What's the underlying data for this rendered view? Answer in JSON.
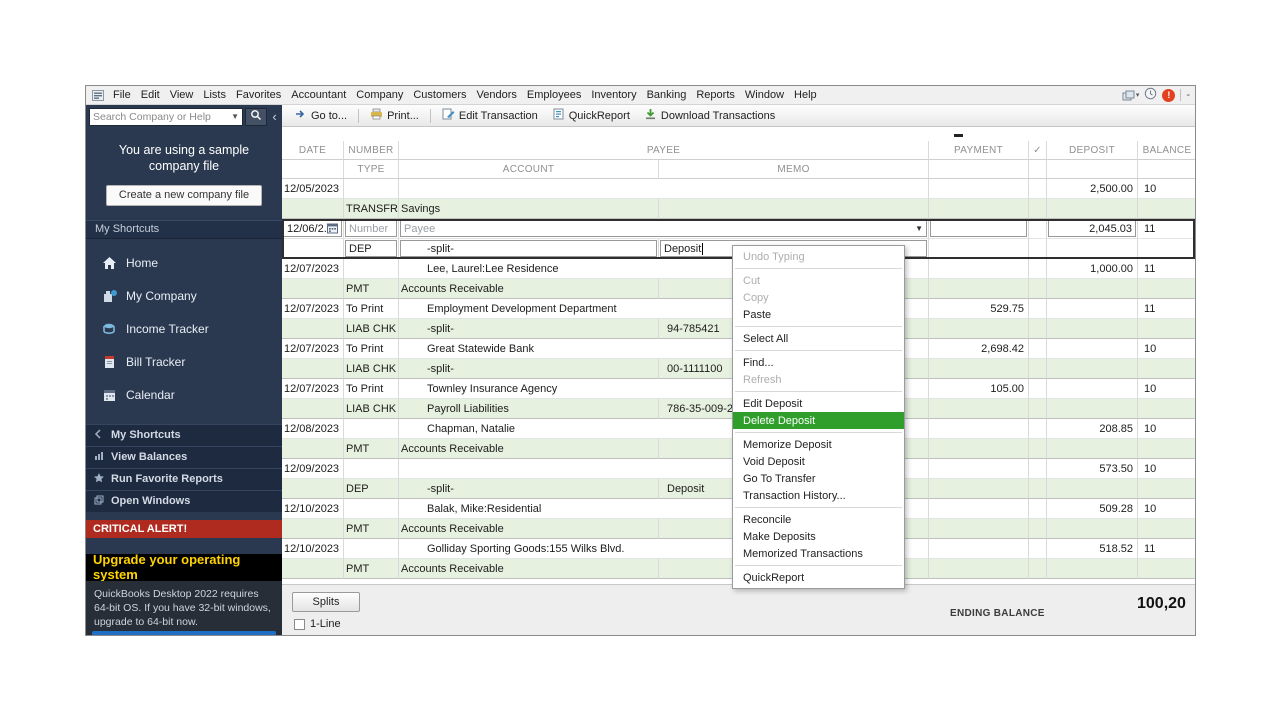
{
  "menubar": {
    "items": [
      "File",
      "Edit",
      "View",
      "Lists",
      "Favorites",
      "Accountant",
      "Company",
      "Customers",
      "Vendors",
      "Employees",
      "Inventory",
      "Banking",
      "Reports",
      "Window",
      "Help"
    ]
  },
  "toolbar": {
    "buttons": [
      {
        "label": "Go to...",
        "icon": "go-to-arrow-icon"
      },
      {
        "label": "Print...",
        "icon": "printer-icon"
      },
      {
        "label": "Edit Transaction",
        "icon": "edit-transaction-icon"
      },
      {
        "label": "QuickReport",
        "icon": "quickreport-icon"
      },
      {
        "label": "Download Transactions",
        "icon": "download-icon"
      }
    ]
  },
  "sidebar": {
    "search_placeholder": "Search Company or Help",
    "sample_banner": "You are using a sample company file",
    "create_company_button": "Create a new company file",
    "shortcuts_header": "My Shortcuts",
    "shortcuts": [
      {
        "label": "Home",
        "icon": "home-icon"
      },
      {
        "label": "My Company",
        "icon": "my-company-icon"
      },
      {
        "label": "Income Tracker",
        "icon": "income-tracker-icon"
      },
      {
        "label": "Bill Tracker",
        "icon": "bill-tracker-icon"
      },
      {
        "label": "Calendar",
        "icon": "calendar-icon"
      }
    ],
    "panels": [
      {
        "label": "My Shortcuts",
        "icon": "my-shortcuts-icon"
      },
      {
        "label": "View Balances",
        "icon": "view-balances-icon"
      },
      {
        "label": "Run Favorite Reports",
        "icon": "favorite-reports-icon"
      },
      {
        "label": "Open Windows",
        "icon": "open-windows-icon"
      }
    ],
    "critical_alert": "CRITICAL ALERT!",
    "upgrade_headline": "Upgrade your operating system",
    "upgrade_body": "QuickBooks Desktop 2022 requires 64-bit OS. If you have 32-bit windows, upgrade to 64-bit now."
  },
  "register": {
    "headers": {
      "date": "DATE",
      "number": "NUMBER",
      "type": "TYPE",
      "payee": "PAYEE",
      "account": "ACCOUNT",
      "memo": "MEMO",
      "payment": "PAYMENT",
      "check": "✓",
      "deposit": "DEPOSIT",
      "balance": "BALANCE"
    },
    "edit_row": {
      "date": "12/06/2...",
      "number_placeholder": "Number",
      "payee_placeholder": "Payee",
      "type": "DEP",
      "account": "-split-",
      "memo": "Deposit",
      "deposit": "2,045.03",
      "balance": "11"
    },
    "rows": [
      {
        "date": "12/05/2023",
        "number": "",
        "type": "TRANSFR",
        "payee": "",
        "account": "Savings",
        "memo": "",
        "payment": "",
        "deposit": "2,500.00",
        "balance": "10"
      },
      {
        "date": "12/07/2023",
        "number": "",
        "type": "PMT",
        "payee": "Lee, Laurel:Lee Residence",
        "account": "Accounts Receivable",
        "memo": "",
        "payment": "",
        "deposit": "1,000.00",
        "balance": "11"
      },
      {
        "date": "12/07/2023",
        "number": "To Print",
        "type": "LIAB CHK",
        "payee": "Employment Development Department",
        "account": "-split-",
        "memo": "94-785421",
        "payment": "529.75",
        "deposit": "",
        "balance": "11"
      },
      {
        "date": "12/07/2023",
        "number": "To Print",
        "type": "LIAB CHK",
        "payee": "Great Statewide Bank",
        "account": "-split-",
        "memo": "00-1111100",
        "payment": "2,698.42",
        "deposit": "",
        "balance": "10"
      },
      {
        "date": "12/07/2023",
        "number": "To Print",
        "type": "LIAB CHK",
        "payee": "Townley Insurance Agency",
        "account": "Payroll Liabilities",
        "memo": "786-35-009-2",
        "payment": "105.00",
        "deposit": "",
        "balance": "10"
      },
      {
        "date": "12/08/2023",
        "number": "",
        "type": "PMT",
        "payee": "Chapman, Natalie",
        "account": "Accounts Receivable",
        "memo": "",
        "payment": "",
        "deposit": "208.85",
        "balance": "10"
      },
      {
        "date": "12/09/2023",
        "number": "",
        "type": "DEP",
        "payee": "",
        "account": "-split-",
        "memo": "Deposit",
        "payment": "",
        "deposit": "573.50",
        "balance": "10"
      },
      {
        "date": "12/10/2023",
        "number": "",
        "type": "PMT",
        "payee": "Balak, Mike:Residential",
        "account": "Accounts Receivable",
        "memo": "",
        "payment": "",
        "deposit": "509.28",
        "balance": "10"
      },
      {
        "date": "12/10/2023",
        "number": "",
        "type": "PMT",
        "payee": "Golliday Sporting Goods:155 Wilks Blvd.",
        "account": "Accounts Receivable",
        "memo": "",
        "payment": "",
        "deposit": "518.52",
        "balance": "11"
      }
    ],
    "footer": {
      "splits_button": "Splits",
      "one_line_label": "1-Line",
      "ending_balance_label": "ENDING BALANCE",
      "ending_balance_value": "100,20"
    }
  },
  "context_menu": {
    "items": [
      {
        "label": "Undo Typing",
        "state": "disabled"
      },
      {
        "label": "Cut",
        "state": "disabled"
      },
      {
        "label": "Copy",
        "state": "disabled"
      },
      {
        "label": "Paste",
        "state": "normal"
      },
      {
        "label": "Select All",
        "state": "normal"
      },
      {
        "label": "Find...",
        "state": "normal"
      },
      {
        "label": "Refresh",
        "state": "disabled"
      },
      {
        "label": "Edit Deposit",
        "state": "normal"
      },
      {
        "label": "Delete Deposit",
        "state": "highlighted"
      },
      {
        "label": "Memorize Deposit",
        "state": "normal"
      },
      {
        "label": "Void Deposit",
        "state": "normal"
      },
      {
        "label": "Go To Transfer",
        "state": "normal"
      },
      {
        "label": "Transaction History...",
        "state": "normal"
      },
      {
        "label": "Reconcile",
        "state": "normal"
      },
      {
        "label": "Make Deposits",
        "state": "normal"
      },
      {
        "label": "Memorized Transactions",
        "state": "normal"
      },
      {
        "label": "QuickReport",
        "state": "normal"
      }
    ]
  },
  "colors": {
    "highlight_green": "#2f9e2b",
    "alert_red": "#b02b1f",
    "upgrade_yellow": "#ffd400",
    "sidebar_navy": "#2a3950",
    "row_green": "#e6f1df"
  }
}
